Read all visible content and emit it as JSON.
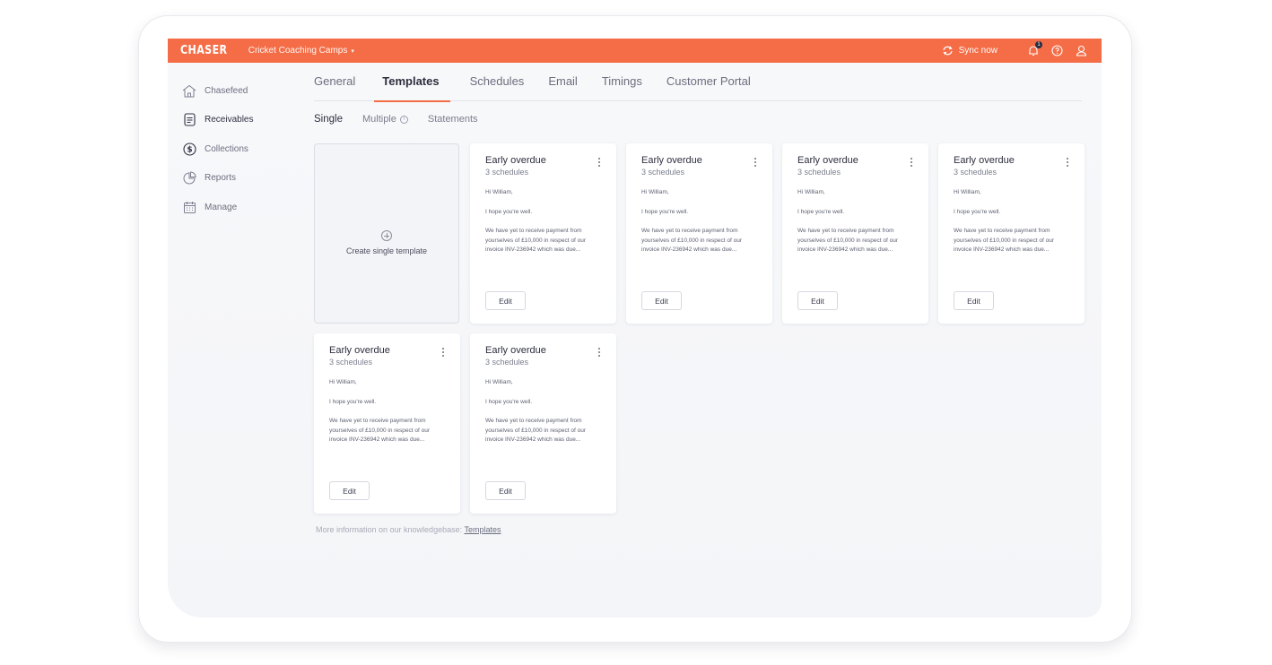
{
  "topbar": {
    "logo": "CHASER",
    "org_name": "Cricket Coaching Camps",
    "org_caret": "▾",
    "sync_label": "Sync now",
    "notification_count": "1"
  },
  "sidebar": {
    "items": [
      {
        "label": "Chasefeed",
        "icon": "home-icon"
      },
      {
        "label": "Receivables",
        "icon": "document-icon"
      },
      {
        "label": "Collections",
        "icon": "dollar-icon"
      },
      {
        "label": "Reports",
        "icon": "chart-icon"
      },
      {
        "label": "Manage",
        "icon": "calendar-icon"
      }
    ],
    "active_index": 1
  },
  "tabs": [
    {
      "label": "General"
    },
    {
      "label": "Templates"
    },
    {
      "label": "Schedules"
    },
    {
      "label": "Email"
    },
    {
      "label": "Timings"
    },
    {
      "label": "Customer Portal"
    }
  ],
  "subtabs": [
    {
      "label": "Single"
    },
    {
      "label": "Multiple"
    },
    {
      "label": "Statements"
    }
  ],
  "create_card": {
    "label": "Create single template"
  },
  "cards": [
    {
      "title": "Early overdue",
      "subtitle": "3 schedules",
      "greeting": "Hi William,",
      "line2": "I hope you're well.",
      "line3": "We have yet to receive payment from yourselves of £10,000 in respect of  our invoice INV-236942 which was due...",
      "edit_label": "Edit"
    },
    {
      "title": "Early overdue",
      "subtitle": "3 schedules",
      "greeting": "Hi William,",
      "line2": "I hope you're well.",
      "line3": "We have yet to receive payment from yourselves of £10,000 in respect of  our invoice INV-236942 which was due...",
      "edit_label": "Edit"
    },
    {
      "title": "Early overdue",
      "subtitle": "3 schedules",
      "greeting": "Hi William,",
      "line2": "I hope you're well.",
      "line3": "We have yet to receive payment from yourselves of £10,000 in respect of  our invoice INV-236942 which was due...",
      "edit_label": "Edit"
    },
    {
      "title": "Early overdue",
      "subtitle": "3 schedules",
      "greeting": "Hi William,",
      "line2": "I hope you're well.",
      "line3": "We have yet to receive payment from yourselves of £10,000 in respect of  our invoice INV-236942 which was due...",
      "edit_label": "Edit"
    },
    {
      "title": "Early overdue",
      "subtitle": "3 schedules",
      "greeting": "Hi William,",
      "line2": "I hope you're well.",
      "line3": "We have yet to receive payment from yourselves of £10,000 in respect of  our invoice INV-236942 which was due...",
      "edit_label": "Edit"
    },
    {
      "title": "Early overdue",
      "subtitle": "3 schedules",
      "greeting": "Hi William,",
      "line2": "I hope you're well.",
      "line3": "We have yet to receive payment from yourselves of £10,000 in respect of  our invoice INV-236942 which was due...",
      "edit_label": "Edit"
    }
  ],
  "footer": {
    "text": "More information on our knowledgebase: ",
    "link": "Templates"
  },
  "colors": {
    "brand": "#f46d47",
    "text_dark": "#2c2e3e",
    "text_muted": "#6c6f80"
  }
}
